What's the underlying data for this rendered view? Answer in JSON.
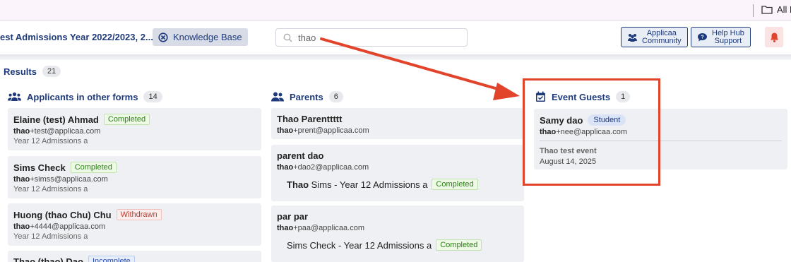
{
  "bookmarks": {
    "all_bookmarks_label": "All B"
  },
  "header": {
    "form_title": "est Admissions Year 2022/2023, 2...",
    "knowledge_base_label": "Knowledge Base",
    "search_value": "thao",
    "community_line1": "Applicaa",
    "community_line2": "Community",
    "help_line1": "Help Hub",
    "help_line2": "Support"
  },
  "results": {
    "label": "Results",
    "count": "21"
  },
  "applicants": {
    "title": "Applicants in other forms",
    "count": "14",
    "items": [
      {
        "name": "Elaine (test) Ahmad",
        "status": "Completed",
        "email_bold": "thao",
        "email_rest": "+test@applicaa.com",
        "form": "Year 12 Admissions a"
      },
      {
        "name": "Sims Check",
        "status": "Completed",
        "email_bold": "thao",
        "email_rest": "+simss@applicaa.com",
        "form": "Year 12 Admissions a"
      },
      {
        "name": "Huong (thao Chu) Chu",
        "status": "Withdrawn",
        "email_bold": "thao",
        "email_rest": "+4444@applicaa.com",
        "form": "Year 12 Admissions a"
      },
      {
        "name": "Thao (thao) Dao",
        "status": "Incomplete"
      }
    ]
  },
  "parents": {
    "title": "Parents",
    "count": "6",
    "items": [
      {
        "name": "Thao Parenttttt",
        "email_bold": "thao",
        "email_rest": "+prent@applicaa.com"
      },
      {
        "name": "parent dao",
        "email_bold": "thao",
        "email_rest": "+dao2@applicaa.com",
        "child_bold": "Thao",
        "child_rest": " Sims - Year 12 Admissions a",
        "child_status": "Completed"
      },
      {
        "name": "par par",
        "email_bold": "thao",
        "email_rest": "+paa@applicaa.com",
        "child_rest": "Sims Check - Year 12 Admissions a",
        "child_status": "Completed"
      }
    ]
  },
  "event_guests": {
    "title": "Event Guests",
    "count": "1",
    "items": [
      {
        "name": "Samy dao",
        "role": "Student",
        "email_bold": "thao",
        "email_rest": "+nee@applicaa.com",
        "event": "Thao test event",
        "date": "August 14, 2025"
      }
    ]
  },
  "colors": {
    "accent": "#1f3a7a",
    "annotation": "#e2432b"
  },
  "icons": [
    "folder-icon",
    "x-circle-icon",
    "search-icon",
    "community-icon",
    "help-chat-icon",
    "bell-icon",
    "users-icon",
    "parents-icon",
    "calendar-icon",
    "arrow-annotation"
  ]
}
